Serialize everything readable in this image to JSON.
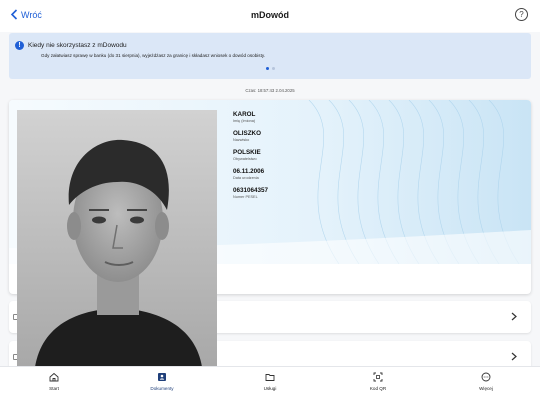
{
  "header": {
    "back_label": "Wróć",
    "title": "mDowód",
    "help_icon": "question-circle-icon"
  },
  "banner": {
    "title": "Kiedy nie skorzystasz z mDowodu",
    "text": "Gdy załatwiasz sprawę w banku (do 31 sierpnia), wyjeżdżasz za granicę i składasz wniosek o dowód osobisty.",
    "pages": 2,
    "active_page": 1
  },
  "timestamp": "Czas: 18:57:43 2.04.2025",
  "card": {
    "fields": [
      {
        "value": "KAROL",
        "label": "Imię (Imiona)"
      },
      {
        "value": "OLISZKO",
        "label": "Nazwisko"
      },
      {
        "value": "POLSKIE",
        "label": "Obywatelstwo"
      },
      {
        "value": "06.11.2006",
        "label": "Data urodzenia"
      },
      {
        "value": "0631064357",
        "label": "Numer PESEL"
      }
    ]
  },
  "nav": {
    "items": [
      {
        "label": "Start",
        "icon": "home-icon",
        "active": false
      },
      {
        "label": "Dokumenty",
        "icon": "id-card-icon",
        "active": true
      },
      {
        "label": "Usługi",
        "icon": "folder-icon",
        "active": false
      },
      {
        "label": "Kod QR",
        "icon": "qr-scan-icon",
        "active": false
      },
      {
        "label": "Więcej",
        "icon": "more-icon",
        "active": false
      }
    ]
  },
  "colors": {
    "accent": "#1f5fd6",
    "banner_bg": "#dbe7f7",
    "card_pattern": "#cfe6f6"
  }
}
